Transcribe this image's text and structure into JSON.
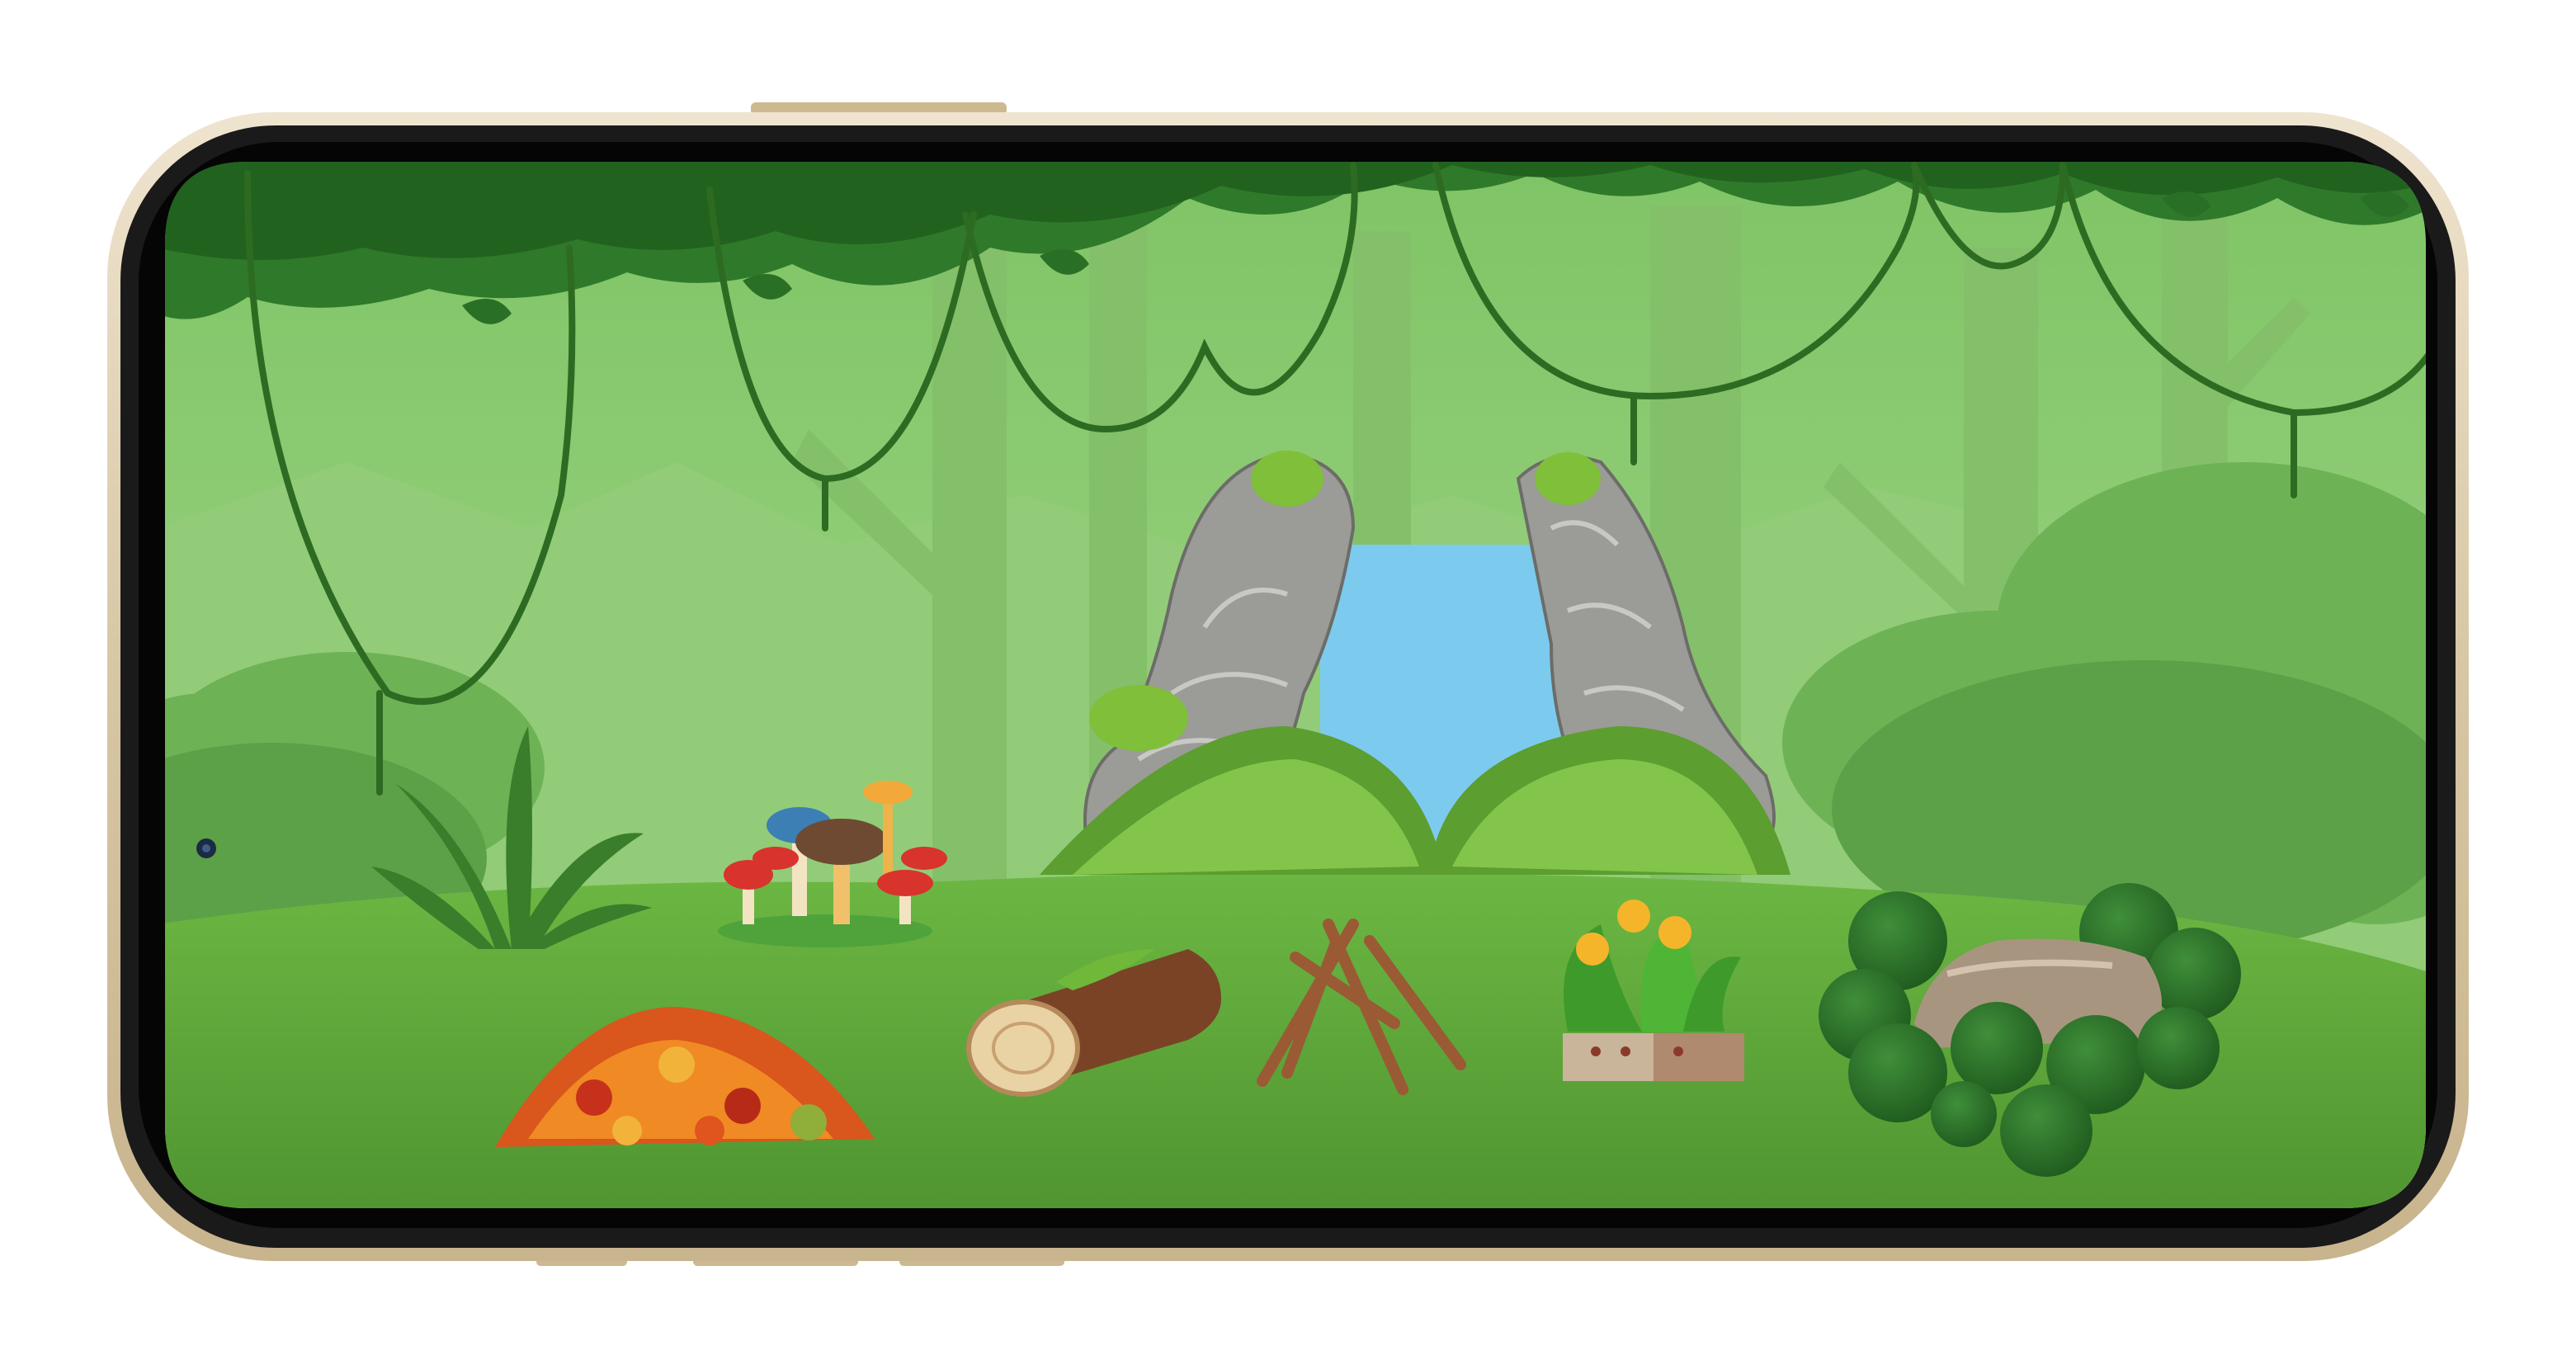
{
  "device": {
    "model_hint": "smartphone",
    "orientation": "landscape",
    "frame_color": "#d9c9a8",
    "bezel_color": "#0b0b0b"
  },
  "scene": {
    "name": "jungle-clearing",
    "sky_color": "#9fd486",
    "canopy_color": "#2f7a2a",
    "ground_color": "#5fa83c",
    "water_color": "#7ccbee",
    "rock_color": "#9b9b97",
    "moss_color": "#7fbf3a"
  },
  "items": [
    {
      "name": "fern-plant",
      "icon": "fern-icon"
    },
    {
      "name": "mushroom-cluster",
      "icon": "mushroom-icon"
    },
    {
      "name": "waterfall-cave",
      "icon": "waterfall-icon"
    },
    {
      "name": "leaf-pile",
      "icon": "autumn-leaves-icon"
    },
    {
      "name": "mossy-log",
      "icon": "log-icon"
    },
    {
      "name": "stick-pile",
      "icon": "campfire-sticks-icon"
    },
    {
      "name": "flower-planter",
      "icon": "flower-icon"
    },
    {
      "name": "bush-rock",
      "icon": "bush-rock-icon"
    }
  ]
}
